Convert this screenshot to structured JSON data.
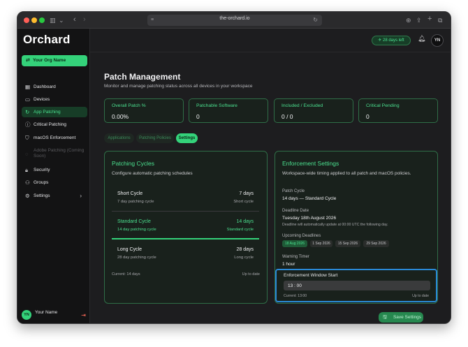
{
  "browser": {
    "url": "the-orchard.io",
    "icons": [
      "sidebar-icon",
      "chevron-down-icon",
      "back-icon",
      "forward-icon",
      "site-settings-icon",
      "reload-icon",
      "download-icon",
      "share-icon",
      "new-tab-icon",
      "tabs-overview-icon"
    ]
  },
  "sidebar": {
    "logo": "Orchard",
    "org_button": "Your Org Name",
    "items": [
      {
        "label": "Dashboard",
        "icon": "dashboard-icon"
      },
      {
        "label": "Devices",
        "icon": "laptop-icon"
      },
      {
        "label": "App Patching",
        "icon": "refresh-icon"
      },
      {
        "label": "Critical Patching",
        "icon": "alert-circle-icon"
      },
      {
        "label": "macOS Enforcement",
        "icon": "shield-icon"
      },
      {
        "label": "Adobe Patching (Coming Soon)",
        "icon": "adobe-icon"
      },
      {
        "label": "Security",
        "icon": "lock-icon"
      },
      {
        "label": "Groups",
        "icon": "users-icon"
      },
      {
        "label": "Settings",
        "icon": "gear-icon"
      }
    ],
    "user": {
      "initials": "YN",
      "name": "Your Name"
    }
  },
  "topbar": {
    "days_left": "28 days left",
    "avatar_initials": "YN"
  },
  "page": {
    "title": "Patch Management",
    "subtitle": "Monitor and manage patching status across all devices in your workspace"
  },
  "stats": [
    {
      "label": "Overall Patch %",
      "value": "0.00%"
    },
    {
      "label": "Patchable Software",
      "value": "0"
    },
    {
      "label": "Included / Excluded",
      "value": "0 / 0"
    },
    {
      "label": "Critical Pending",
      "value": "0"
    }
  ],
  "tabs": [
    "Applications",
    "Patching Policies",
    "Settings"
  ],
  "patching_cycles": {
    "title": "Patching Cycles",
    "subtitle": "Configure automatic patching schedules",
    "cycles": [
      {
        "name": "Short Cycle",
        "desc": "7 day patching cycle",
        "days": "7 days",
        "type": "Short cycle"
      },
      {
        "name": "Standard Cycle",
        "desc": "14 day patching cycle",
        "days": "14 days",
        "type": "Standard cycle"
      },
      {
        "name": "Long Cycle",
        "desc": "28 day patching cycle",
        "days": "28 days",
        "type": "Long cycle"
      }
    ],
    "current": "Current: 14 days",
    "status": "Up to date"
  },
  "enforcement": {
    "title": "Enforcement Settings",
    "subtitle": "Workspace-wide timing applied to all patch and macOS policies.",
    "patch_cycle_label": "Patch Cycle",
    "patch_cycle_value": "14 days — Standard Cycle",
    "deadline_label": "Deadline Date",
    "deadline_value": "Tuesday 18th August 2026",
    "deadline_note": "Deadline will automatically update at 00:00 UTC the following day.",
    "upcoming_label": "Upcoming Deadlines",
    "upcoming": [
      "18 Aug 2026",
      "1 Sep 2026",
      "15 Sep 2026",
      "29 Sep 2026"
    ],
    "warning_label": "Warning Timer",
    "warning_value": "1 hour",
    "window_label": "Enforcement Window Start",
    "window_value": "13 : 00",
    "window_current": "Current: 13:00",
    "window_status": "Up to date"
  },
  "save_label": "Save Settings",
  "colors": {
    "accent": "#34d27a",
    "focus": "#2a8ad8",
    "danger": "#ff6b5a"
  }
}
